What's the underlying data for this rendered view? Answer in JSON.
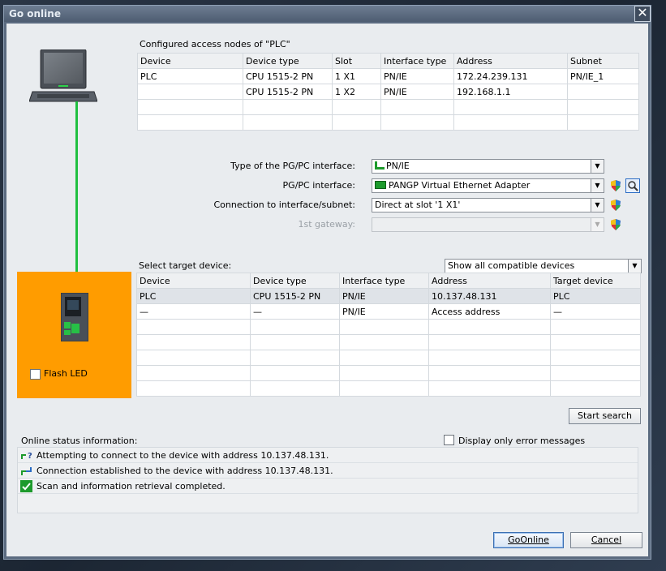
{
  "window": {
    "title": "Go online",
    "close_glyph": "✕"
  },
  "configured": {
    "heading": "Configured access nodes of \"PLC\"",
    "columns": [
      "Device",
      "Device type",
      "Slot",
      "Interface type",
      "Address",
      "Subnet"
    ],
    "rows": [
      [
        "PLC",
        "CPU 1515-2 PN",
        "1 X1",
        "PN/IE",
        "172.24.239.131",
        "PN/IE_1"
      ],
      [
        "",
        "CPU 1515-2 PN",
        "1 X2",
        "PN/IE",
        "192.168.1.1",
        ""
      ],
      [
        "",
        "",
        "",
        "",
        "",
        ""
      ],
      [
        "",
        "",
        "",
        "",
        "",
        ""
      ]
    ]
  },
  "iface": {
    "type_label": "Type of the PG/PC interface:",
    "type_value": "PN/IE",
    "pgpc_label": "PG/PC interface:",
    "pgpc_value": "PANGP Virtual Ethernet Adapter",
    "conn_label": "Connection to interface/subnet:",
    "conn_value": "Direct at slot '1 X1'",
    "gateway_label": "1st gateway:",
    "gateway_value": ""
  },
  "target": {
    "heading": "Select target device:",
    "filter_value": "Show all compatible devices",
    "columns": [
      "Device",
      "Device type",
      "Interface type",
      "Address",
      "Target device"
    ],
    "rows": [
      [
        "PLC",
        "CPU 1515-2 PN",
        "PN/IE",
        "10.137.48.131",
        "PLC"
      ],
      [
        "—",
        "—",
        "PN/IE",
        "Access address",
        "—"
      ],
      [
        "",
        "",
        "",
        "",
        ""
      ],
      [
        "",
        "",
        "",
        "",
        ""
      ],
      [
        "",
        "",
        "",
        "",
        ""
      ],
      [
        "",
        "",
        "",
        "",
        ""
      ],
      [
        "",
        "",
        "",
        "",
        ""
      ]
    ]
  },
  "flash_led": {
    "label": "Flash LED",
    "checked": false
  },
  "start_search": {
    "label": "Start search"
  },
  "status": {
    "heading": "Online status information:",
    "error_only_label": "Display only error messages",
    "messages": [
      {
        "icon": "connecting-icon",
        "text": "Attempting to connect to the device with address 10.137.48.131."
      },
      {
        "icon": "connected-icon",
        "text": "Connection established to the device with address 10.137.48.131."
      },
      {
        "icon": "check-icon",
        "text": "Scan and information retrieval completed."
      }
    ]
  },
  "buttons": {
    "go_online": "GoOnline",
    "cancel": "Cancel"
  },
  "colors": {
    "accent_orange": "#ff9c00",
    "link_green": "#20c040",
    "window_frame": "#5b6b80"
  }
}
